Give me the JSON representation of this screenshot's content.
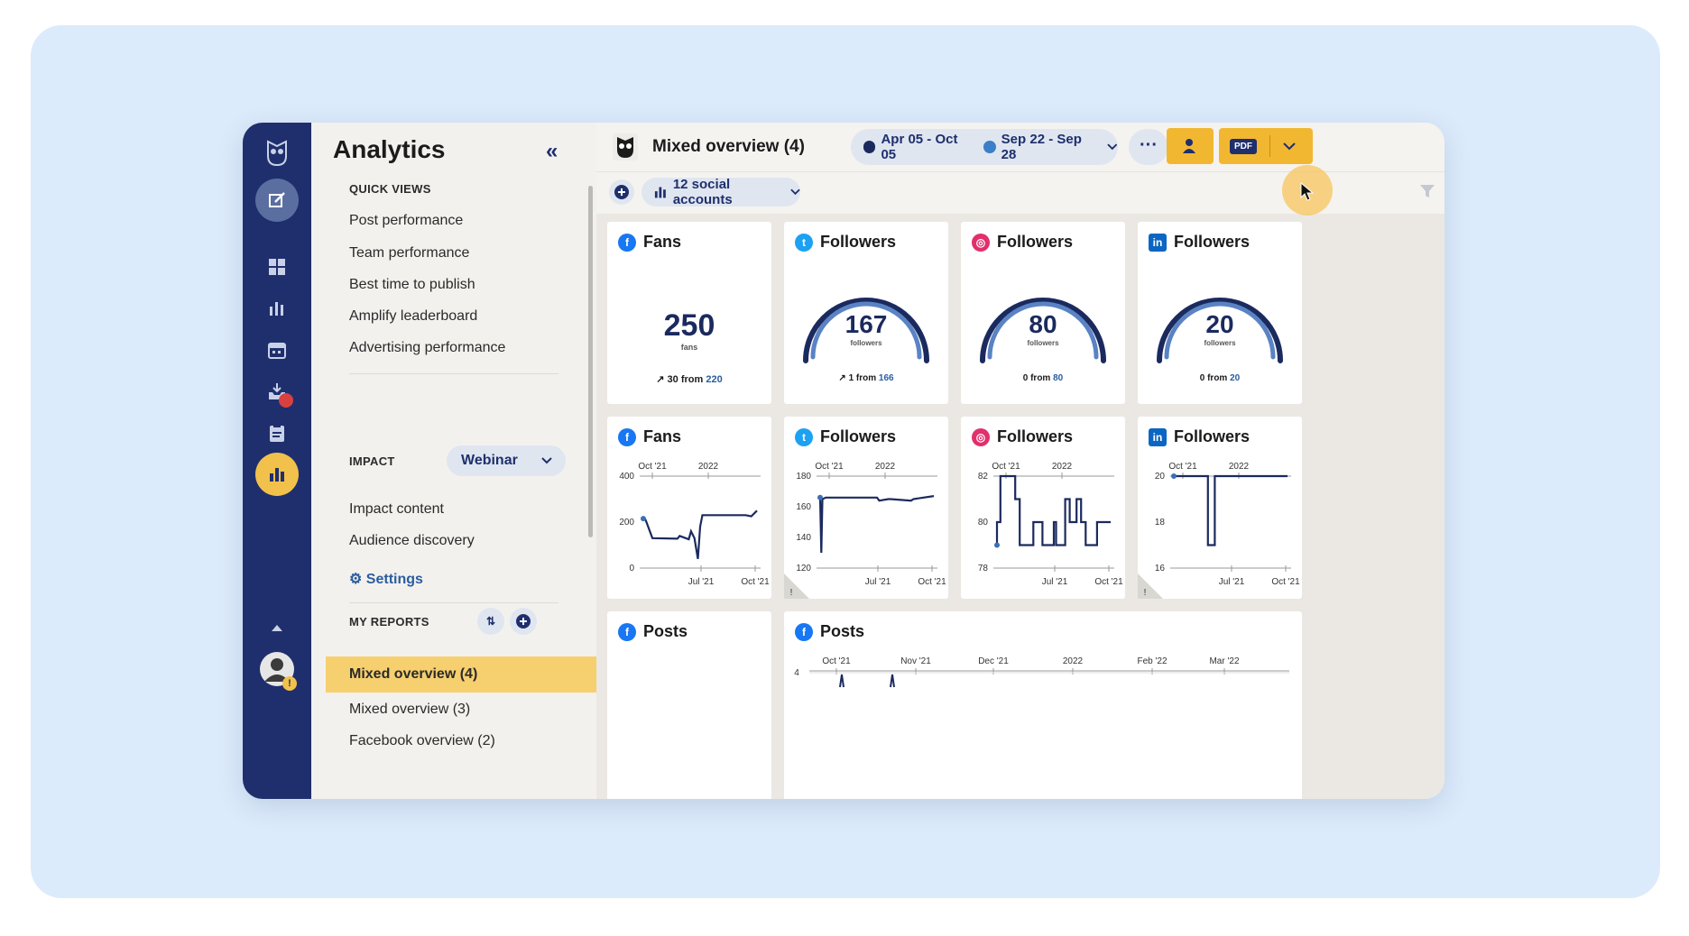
{
  "nav": {
    "title": "Analytics",
    "quick_views_label": "QUICK VIEWS",
    "quick_views": [
      "Post performance",
      "Team performance",
      "Best time to publish",
      "Amplify leaderboard",
      "Advertising performance"
    ],
    "impact_label": "IMPACT",
    "impact_dropdown": "Webinar",
    "impact_items": [
      "Impact content",
      "Audience discovery"
    ],
    "settings_label": "Settings",
    "my_reports_label": "MY REPORTS",
    "reports": [
      "Mixed overview (4)",
      "Mixed overview (3)",
      "Facebook overview (2)"
    ]
  },
  "header": {
    "title": "Mixed overview (4)",
    "date_range_1": "Apr 05 - Oct 05",
    "date_range_2": "Sep 22 - Sep 28",
    "more": "···",
    "pdf": "PDF"
  },
  "filter": {
    "accounts": "12 social accounts"
  },
  "colors": {
    "rail": "#1f2f6d",
    "accent": "#f2b731",
    "facebook": "#1877f2",
    "twitter": "#1da1f2",
    "instagram": "#e1306c",
    "linkedin": "#0a66c2",
    "line": "#1b2a5e",
    "gauge_dark": "#1b2a5e",
    "gauge_light": "#5a83c4"
  },
  "summary_cards": [
    {
      "network": "facebook",
      "title": "Fans",
      "value": "250",
      "unit": "fans",
      "delta_arrow": "↗",
      "delta": "30",
      "from": "from",
      "prev": "220"
    },
    {
      "network": "twitter",
      "title": "Followers",
      "value": "167",
      "unit": "followers",
      "delta_arrow": "↗",
      "delta": "1",
      "from": "from",
      "prev": "166"
    },
    {
      "network": "instagram",
      "title": "Followers",
      "value": "80",
      "unit": "followers",
      "delta_arrow": "",
      "delta": "0",
      "from": "from",
      "prev": "80"
    },
    {
      "network": "linkedin",
      "title": "Followers",
      "value": "20",
      "unit": "followers",
      "delta_arrow": "",
      "delta": "0",
      "from": "from",
      "prev": "20"
    }
  ],
  "chart_data": [
    {
      "type": "line",
      "network": "facebook",
      "title": "Fans",
      "top_ticks": [
        "Oct '21",
        "2022"
      ],
      "bottom_ticks": [
        "Jul '21",
        "Oct '21"
      ],
      "y_ticks": [
        "400",
        "200",
        "0"
      ],
      "ylim": [
        0,
        400
      ],
      "x": [
        0,
        0.02,
        0.08,
        0.3,
        0.32,
        0.4,
        0.42,
        0.45,
        0.48,
        0.5,
        0.52,
        0.9,
        0.95,
        1.0
      ],
      "values": [
        215,
        210,
        130,
        128,
        140,
        125,
        160,
        130,
        40,
        180,
        230,
        230,
        225,
        250
      ]
    },
    {
      "type": "line",
      "network": "twitter",
      "title": "Followers",
      "top_ticks": [
        "Oct '21",
        "2022"
      ],
      "bottom_ticks": [
        "Jul '21",
        "Oct '21"
      ],
      "y_ticks": [
        "180",
        "160",
        "140",
        "120"
      ],
      "ylim": [
        120,
        180
      ],
      "x": [
        0,
        0.01,
        0.02,
        0.05,
        0.5,
        0.52,
        0.6,
        0.62,
        0.8,
        0.82,
        1.0
      ],
      "values": [
        166,
        130,
        165,
        166,
        166,
        164,
        165,
        165,
        164,
        165,
        167
      ]
    },
    {
      "type": "line",
      "network": "instagram",
      "title": "Followers",
      "top_ticks": [
        "Oct '21",
        "2022"
      ],
      "bottom_ticks": [
        "Jul '21",
        "Oct '21"
      ],
      "y_ticks": [
        "82",
        "80",
        "78"
      ],
      "ylim": [
        78,
        82
      ],
      "x": [
        0,
        0.0,
        0.03,
        0.03,
        0.16,
        0.16,
        0.2,
        0.2,
        0.32,
        0.32,
        0.4,
        0.4,
        0.5,
        0.5,
        0.52,
        0.52,
        0.6,
        0.6,
        0.64,
        0.64,
        0.7,
        0.7,
        0.74,
        0.74,
        0.78,
        0.78,
        0.88,
        0.88,
        1.0
      ],
      "values": [
        79,
        80,
        80,
        82,
        82,
        81,
        81,
        79,
        79,
        80,
        80,
        79,
        79,
        80,
        80,
        79,
        79,
        81,
        81,
        80,
        80,
        81,
        81,
        80,
        80,
        79,
        79,
        80,
        80
      ]
    },
    {
      "type": "line",
      "network": "linkedin",
      "title": "Followers",
      "top_ticks": [
        "Oct '21",
        "2022"
      ],
      "bottom_ticks": [
        "Jul '21",
        "Oct '21"
      ],
      "y_ticks": [
        "20",
        "18",
        "16"
      ],
      "ylim": [
        16,
        20
      ],
      "x": [
        0,
        0.3,
        0.3,
        0.36,
        0.36,
        1.0
      ],
      "values": [
        20,
        20,
        17,
        17,
        20,
        20
      ]
    }
  ],
  "posts_cards": [
    {
      "network": "facebook",
      "title": "Posts"
    },
    {
      "network": "facebook",
      "title": "Posts",
      "x_ticks": [
        "Oct '21",
        "Nov '21",
        "Dec '21",
        "2022",
        "Feb '22",
        "Mar '22"
      ],
      "y_tick": "4"
    }
  ]
}
